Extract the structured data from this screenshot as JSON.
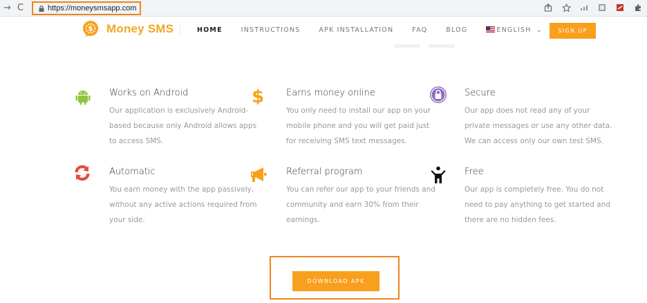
{
  "browser": {
    "url": "https://moneysmsapp.com",
    "back_glyph": "→",
    "reload_glyph": "C"
  },
  "brand": {
    "name": "Money SMS",
    "accent": "#f8a01d",
    "highlight": "#f0831e"
  },
  "nav": {
    "items": [
      "HOME",
      "INSTRUCTIONS",
      "APK INSTALLATION",
      "FAQ",
      "BLOG"
    ],
    "language": "ENGLISH",
    "language_caret": "⌄",
    "signup": "SIGN UP"
  },
  "features": [
    {
      "icon": "android-icon",
      "icon_color": "#8dc63f",
      "title": "Works on Android",
      "lines": [
        "Our application is exclusively Android-",
        "based because only Android allows apps",
        "to access SMS."
      ]
    },
    {
      "icon": "dollar-icon",
      "icon_color": "#f8a01d",
      "title": "Earns money online",
      "lines": [
        "You only need to install our app on your",
        "mobile phone and you will get paid just",
        "for receiving SMS text messages."
      ]
    },
    {
      "icon": "lock-circle-icon",
      "icon_color": "#8e6bbf",
      "title": "Secure",
      "lines": [
        "Our app does not read any of your",
        "private messages or use any other data.",
        "We can access only our own test SMS."
      ]
    },
    {
      "icon": "refresh-icon",
      "icon_color": "#e8483f",
      "title": "Automatic",
      "lines": [
        "You earn money with the app passively,",
        "without any active actions required from",
        "your side."
      ]
    },
    {
      "icon": "megaphone-icon",
      "icon_color": "#f8a01d",
      "title": "Referral program",
      "lines": [
        "You can refer our app to your friends and",
        "community and earn 30% from their",
        "earnings."
      ]
    },
    {
      "icon": "person-icon",
      "icon_color": "#111111",
      "title": "Free",
      "lines": [
        "Our app is completely free. You do not",
        "need to pay anything to get started and",
        "there are no hidden fees."
      ]
    }
  ],
  "download": {
    "label": "DOWNLOAD APK"
  }
}
